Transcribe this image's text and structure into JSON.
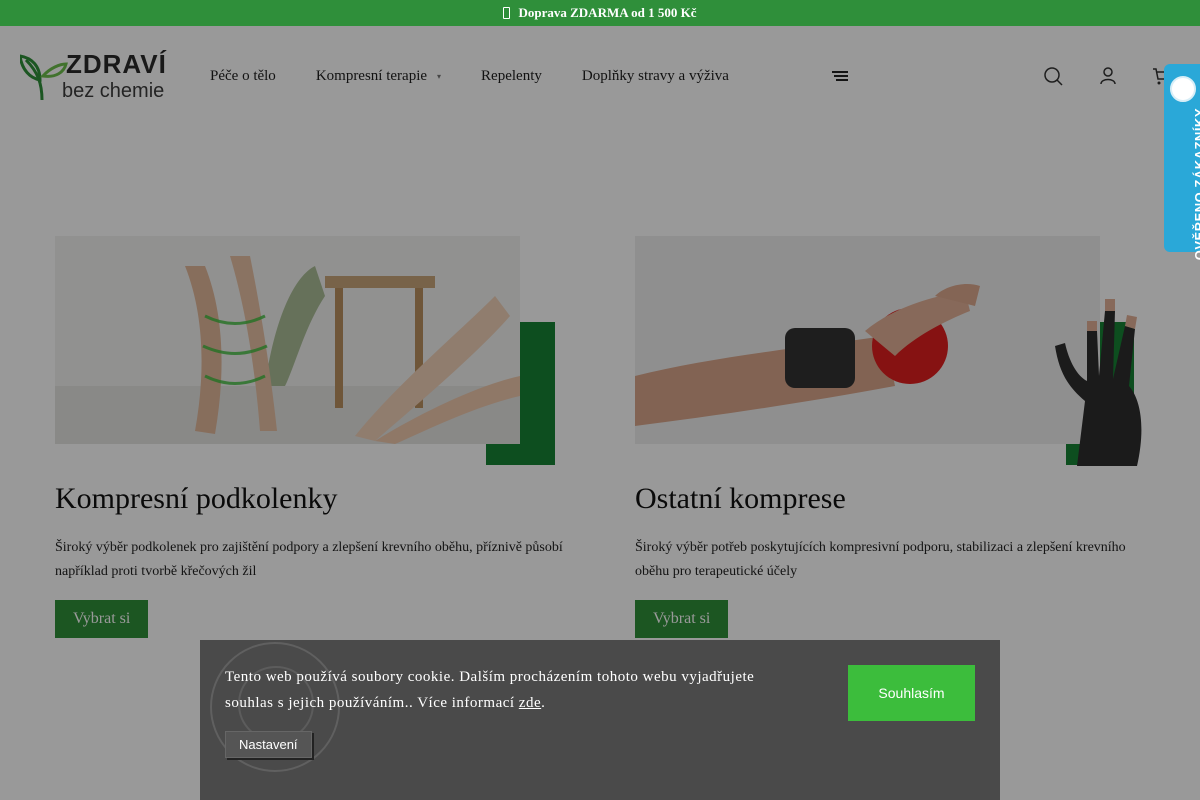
{
  "topbar": {
    "text": "Doprava ZDARMA od 1 500 Kč"
  },
  "logo": {
    "brand": "ZDRAVÍ",
    "sub": "bez chemie"
  },
  "nav": {
    "items": [
      {
        "label": "Péče o tělo"
      },
      {
        "label": "Kompresní terapie",
        "has_dropdown": true
      },
      {
        "label": "Repelenty"
      },
      {
        "label": "Doplňky stravy a výživa"
      }
    ]
  },
  "header_icons": [
    "menu-icon",
    "search-icon",
    "user-icon",
    "cart-icon"
  ],
  "verified_badge": {
    "text": "OVĚŘENO ZÁKAZNÍKY"
  },
  "cards": [
    {
      "title": "Kompresní podkolenky",
      "description": "Široký výběr podkolenek pro zajištění podpory a zlepšení krevního oběhu, příznivě působí například proti tvorbě křečových žil",
      "button": "Vybrat si"
    },
    {
      "title": "Ostatní komprese",
      "description": "Široký výběr potřeb poskytujících kompresivní podporu, stabilizaci a zlepšení krevního oběhu pro terapeutické účely",
      "button": "Vybrat si"
    }
  ],
  "cookie": {
    "message": "Tento web používá soubory cookie. Dalším procházením tohoto webu vyjadřujete souhlas s jejich používáním.. Více informací ",
    "link": "zde",
    "suffix": ".",
    "settings_button": "Nastavení",
    "agree_button": "Souhlasím"
  },
  "colors": {
    "brand_green": "#2f8f3a",
    "accent_green": "#178234",
    "agree_green": "#3cbd3c",
    "badge_blue": "#2aa8d8"
  }
}
